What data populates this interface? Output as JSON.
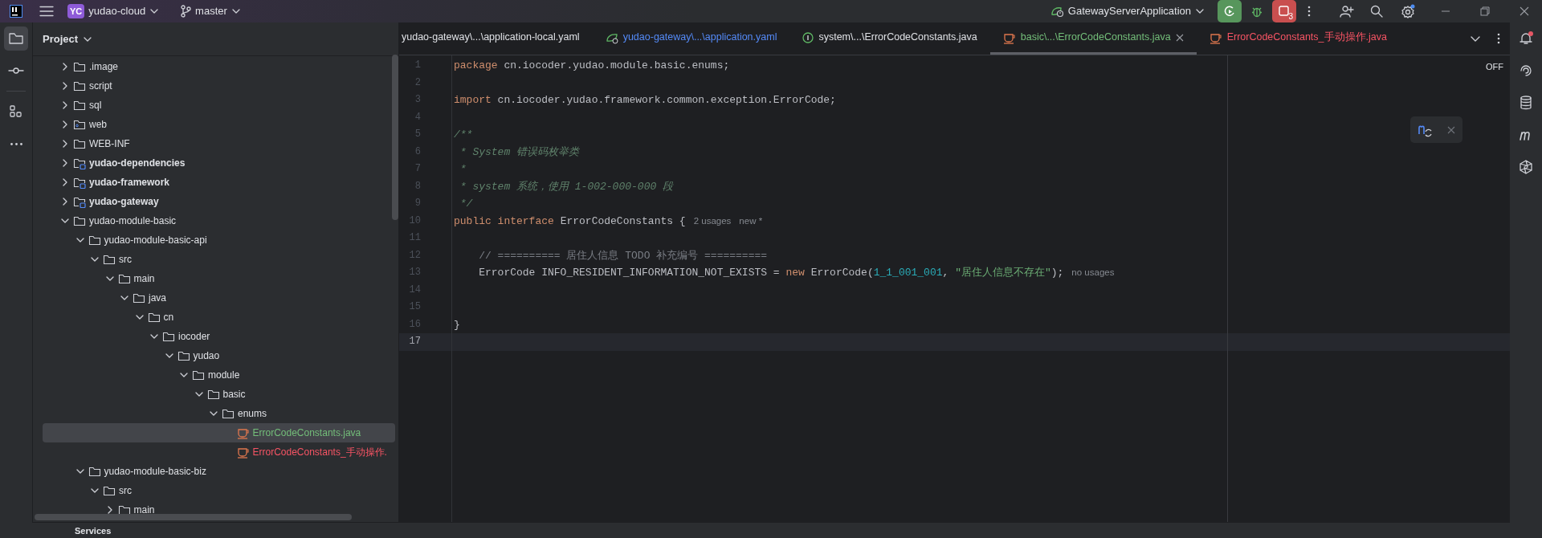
{
  "top_bar": {
    "project_badge": "YC",
    "project_name": "yudao-cloud",
    "branch": "master",
    "run_config": "GatewayServerApplication",
    "problems_count": "3"
  },
  "project_panel": {
    "title": "Project",
    "tree": [
      {
        "label": ".image",
        "kind": "folder",
        "expanded": false,
        "selected": false
      },
      {
        "label": "script",
        "kind": "folder",
        "expanded": false,
        "selected": false
      },
      {
        "label": "sql",
        "kind": "folder",
        "expanded": false,
        "selected": false
      },
      {
        "label": "web",
        "kind": "web",
        "expanded": false,
        "selected": false
      },
      {
        "label": "WEB-INF",
        "kind": "folder",
        "expanded": false,
        "selected": false
      },
      {
        "label": "yudao-dependencies",
        "kind": "module",
        "expanded": false,
        "selected": false
      },
      {
        "label": "yudao-framework",
        "kind": "module",
        "expanded": false,
        "selected": false
      },
      {
        "label": "yudao-gateway",
        "kind": "module",
        "expanded": false,
        "selected": false
      },
      {
        "label": "yudao-module-basic",
        "kind": "folder",
        "expanded": true,
        "selected": false,
        "children": [
          {
            "label": "yudao-module-basic-api",
            "kind": "folder",
            "expanded": true,
            "selected": false,
            "children": [
              {
                "label": "src",
                "kind": "folder",
                "expanded": true,
                "selected": false,
                "children": [
                  {
                    "label": "main",
                    "kind": "folder",
                    "expanded": true,
                    "selected": false,
                    "children": [
                      {
                        "label": "java",
                        "kind": "folder",
                        "expanded": true,
                        "selected": false,
                        "children": [
                          {
                            "label": "cn",
                            "kind": "folder",
                            "expanded": true,
                            "selected": false,
                            "children": [
                              {
                                "label": "iocoder",
                                "kind": "folder",
                                "expanded": true,
                                "selected": false,
                                "children": [
                                  {
                                    "label": "yudao",
                                    "kind": "folder",
                                    "expanded": true,
                                    "selected": false,
                                    "children": [
                                      {
                                        "label": "module",
                                        "kind": "folder",
                                        "expanded": true,
                                        "selected": false,
                                        "children": [
                                          {
                                            "label": "basic",
                                            "kind": "folder",
                                            "expanded": true,
                                            "selected": false,
                                            "children": [
                                              {
                                                "label": "enums",
                                                "kind": "folder",
                                                "expanded": true,
                                                "selected": false,
                                                "children": [
                                                  {
                                                    "label": "ErrorCodeConstants.java",
                                                    "kind": "java",
                                                    "color": "#73bd79",
                                                    "selected": true
                                                  },
                                                  {
                                                    "label": "ErrorCodeConstants_手动操作.",
                                                    "kind": "java",
                                                    "color": "#f75464",
                                                    "selected": false
                                                  }
                                                ]
                                              }
                                            ]
                                          }
                                        ]
                                      }
                                    ]
                                  }
                                ]
                              }
                            ]
                          }
                        ]
                      }
                    ]
                  }
                ]
              }
            ]
          },
          {
            "label": "yudao-module-basic-biz",
            "kind": "folder",
            "expanded": true,
            "selected": false,
            "children": [
              {
                "label": "src",
                "kind": "folder",
                "expanded": true,
                "selected": false,
                "children": [
                  {
                    "label": "main",
                    "kind": "folder",
                    "expanded": false,
                    "selected": false
                  }
                ]
              }
            ]
          }
        ]
      }
    ]
  },
  "tabs": [
    {
      "label": "yudao-gateway\\...\\application-local.yaml",
      "kind": "plain",
      "color": "#dfe1e5",
      "selected": false
    },
    {
      "label": "yudao-gateway\\...\\application.yaml",
      "kind": "yaml",
      "color": "#548af7",
      "selected": false
    },
    {
      "label": "system\\...\\ErrorCodeConstants.java",
      "kind": "interface",
      "color": "#dfe1e5",
      "selected": false
    },
    {
      "label": "basic\\...\\ErrorCodeConstants.java",
      "kind": "java",
      "color": "#73bd79",
      "selected": true
    },
    {
      "label": "ErrorCodeConstants_手动操作.java",
      "kind": "java",
      "color": "#f75464",
      "selected": false
    }
  ],
  "editor": {
    "status_label": "OFF",
    "lines": [
      {
        "number": "1",
        "current": false,
        "tokens": [
          {
            "kind": "keyword",
            "text": "package"
          },
          {
            "kind": "plain",
            "text": " cn.iocoder.yudao.module.basic.enums;"
          }
        ]
      },
      {
        "number": "2",
        "current": false
      },
      {
        "number": "3",
        "current": false,
        "tokens": [
          {
            "kind": "keyword",
            "text": "import"
          },
          {
            "kind": "plain",
            "text": " cn.iocoder.yudao.framework.common.exception.ErrorCode;"
          }
        ]
      },
      {
        "number": "4",
        "current": false
      },
      {
        "number": "5",
        "current": false,
        "tokens": [
          {
            "kind": "doc",
            "text": "/**"
          }
        ]
      },
      {
        "number": "6",
        "current": false,
        "tokens": [
          {
            "kind": "doc",
            "text": " * System 错误码枚举类"
          }
        ]
      },
      {
        "number": "7",
        "current": false,
        "tokens": [
          {
            "kind": "doc",
            "text": " *"
          }
        ]
      },
      {
        "number": "8",
        "current": false,
        "tokens": [
          {
            "kind": "doc",
            "text": " * system 系统，使用 1-002-000-000 段"
          }
        ]
      },
      {
        "number": "9",
        "current": false,
        "tokens": [
          {
            "kind": "doc",
            "text": " */"
          }
        ]
      },
      {
        "number": "10",
        "current": false,
        "tokens": [
          {
            "kind": "keyword",
            "text": "public interface"
          },
          {
            "kind": "plain",
            "text": " ErrorCodeConstants {"
          },
          {
            "kind": "hint",
            "text": "2 usages"
          },
          {
            "kind": "hint",
            "text": "new *"
          }
        ]
      },
      {
        "number": "11",
        "current": false
      },
      {
        "number": "12",
        "current": false,
        "tokens": [
          {
            "kind": "comment",
            "text": "    // ========== 居住人信息 TODO 补充编号 =========="
          }
        ]
      },
      {
        "number": "13",
        "current": false,
        "tokens": [
          {
            "kind": "plain",
            "text": "    ErrorCode INFO_RESIDENT_INFORMATION_NOT_EXISTS = "
          },
          {
            "kind": "keyword",
            "text": "new"
          },
          {
            "kind": "plain",
            "text": " ErrorCode("
          },
          {
            "kind": "number",
            "text": "1_1_001_001"
          },
          {
            "kind": "plain",
            "text": ", "
          },
          {
            "kind": "string",
            "text": "\"居住人信息不存在\""
          },
          {
            "kind": "plain",
            "text": ");"
          },
          {
            "kind": "hint",
            "text": "no usages"
          }
        ]
      },
      {
        "number": "14",
        "current": false
      },
      {
        "number": "15",
        "current": false
      },
      {
        "number": "16",
        "current": false,
        "tokens": [
          {
            "kind": "plain",
            "text": "}"
          }
        ]
      },
      {
        "number": "17",
        "current": true
      }
    ]
  },
  "bottom_panel": {
    "title": "Services"
  }
}
